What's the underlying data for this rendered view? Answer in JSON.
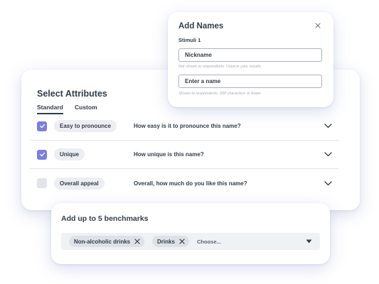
{
  "colors": {
    "accent": "#7b7fdb",
    "text": "#333e48",
    "checkbox_off": "#e2e4e9",
    "pill_bg": "#edeef2",
    "helper_text": "#a7acb5"
  },
  "add_names": {
    "title": "Add Names",
    "stimuli_label": "Stimuli 1",
    "close_icon": "close-icon",
    "nickname": {
      "placeholder": "Nickname",
      "helper": "Not shown to respondents. Used in your results."
    },
    "name": {
      "placeholder": "Enter a name",
      "helper": "Shown to respondents. 300 characters or fewer."
    }
  },
  "select_attributes": {
    "title": "Select Attributes",
    "tabs": [
      {
        "label": "Standard",
        "active": true
      },
      {
        "label": "Custom",
        "active": false
      }
    ],
    "rows": [
      {
        "checked": true,
        "attribute": "Easy to pronounce",
        "question": "How easy is it to pronounce this name?",
        "icon": "chevron-down-icon"
      },
      {
        "checked": true,
        "attribute": "Unique",
        "question": "How unique is this name?",
        "icon": "chevron-down-icon"
      },
      {
        "checked": false,
        "attribute": "Overall appeal",
        "question": "Overall, how much do you like this name?",
        "icon": "chevron-down-icon"
      }
    ]
  },
  "benchmarks": {
    "title": "Add up to 5 benchmarks",
    "chips": [
      {
        "label": "Non-alcoholic drinks",
        "icon": "close-icon"
      },
      {
        "label": "Drinks",
        "icon": "close-icon"
      }
    ],
    "placeholder": "Choose...",
    "dropdown_icon": "caret-down-icon"
  }
}
